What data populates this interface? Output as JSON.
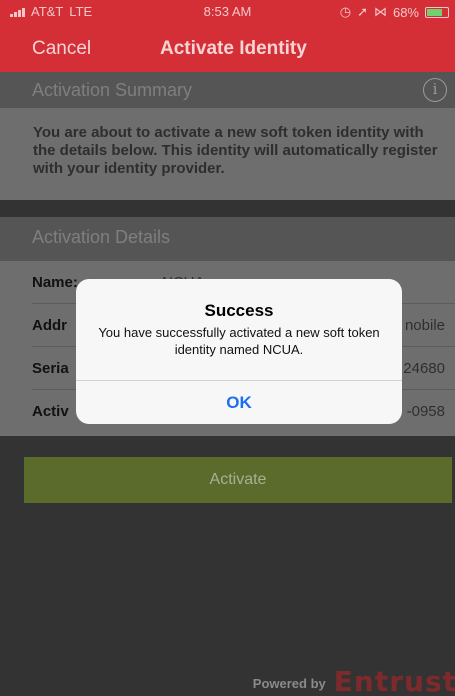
{
  "status_bar": {
    "carrier": "AT&T",
    "network": "LTE",
    "time": "8:53 AM",
    "icons": [
      "alarm-icon",
      "location-icon",
      "bluetooth-icon"
    ],
    "battery_percent": "68%",
    "battery_level": 0.68
  },
  "nav": {
    "cancel_label": "Cancel",
    "title": "Activate Identity"
  },
  "summary": {
    "header": "Activation Summary",
    "info_icon": "i",
    "text": "You are about to activate a new soft token identity with the details below. This identity will automatically register with your identity provider."
  },
  "details": {
    "header": "Activation Details",
    "rows": [
      {
        "label": "Name:",
        "value": "NCUA"
      },
      {
        "label": "Addr",
        "value": "nobile"
      },
      {
        "label": "Seria",
        "value": "24680"
      },
      {
        "label": "Activ",
        "value": "-0958"
      }
    ]
  },
  "activate_label": "Activate",
  "footer": {
    "powered_by": "Powered by",
    "brand": "Entrust"
  },
  "alert": {
    "title": "Success",
    "message": "You have successfully activated a new soft token identity named NCUA.",
    "ok_label": "OK"
  },
  "colors": {
    "brand_red": "#d42f36",
    "alert_button": "#1b6ff2",
    "activate_button": "#5a6b2c"
  }
}
